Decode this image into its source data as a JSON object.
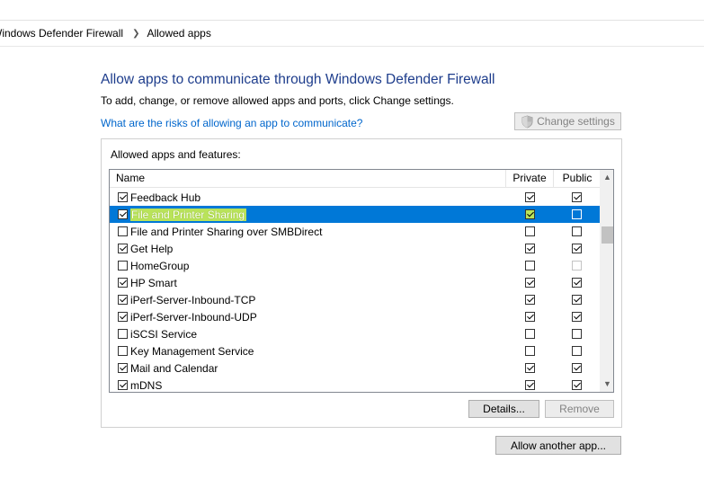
{
  "breadcrumb": {
    "items": [
      "Windows Defender Firewall",
      "Allowed apps"
    ]
  },
  "page": {
    "title": "Allow apps to communicate through Windows Defender Firewall",
    "subtitle": "To add, change, or remove allowed apps and ports, click Change settings.",
    "risk_link": "What are the risks of allowing an app to communicate?",
    "change_settings_label": "Change settings"
  },
  "group": {
    "label": "Allowed apps and features:",
    "columns": {
      "name": "Name",
      "private": "Private",
      "public": "Public"
    },
    "rows": [
      {
        "name": "Feedback Hub",
        "enabled": true,
        "private": true,
        "public": true,
        "selected": false
      },
      {
        "name": "File and Printer Sharing",
        "enabled": true,
        "private": true,
        "public": false,
        "selected": true
      },
      {
        "name": "File and Printer Sharing over SMBDirect",
        "enabled": false,
        "private": false,
        "public": false,
        "selected": false
      },
      {
        "name": "Get Help",
        "enabled": true,
        "private": true,
        "public": true,
        "selected": false
      },
      {
        "name": "HomeGroup",
        "enabled": false,
        "private": false,
        "public": false,
        "selected": false,
        "public_dim": true
      },
      {
        "name": "HP Smart",
        "enabled": true,
        "private": true,
        "public": true,
        "selected": false
      },
      {
        "name": "iPerf-Server-Inbound-TCP",
        "enabled": true,
        "private": true,
        "public": true,
        "selected": false
      },
      {
        "name": "iPerf-Server-Inbound-UDP",
        "enabled": true,
        "private": true,
        "public": true,
        "selected": false
      },
      {
        "name": "iSCSI Service",
        "enabled": false,
        "private": false,
        "public": false,
        "selected": false
      },
      {
        "name": "Key Management Service",
        "enabled": false,
        "private": false,
        "public": false,
        "selected": false
      },
      {
        "name": "Mail and Calendar",
        "enabled": true,
        "private": true,
        "public": true,
        "selected": false
      },
      {
        "name": "mDNS",
        "enabled": true,
        "private": true,
        "public": true,
        "selected": false
      }
    ],
    "details_label": "Details...",
    "remove_label": "Remove"
  },
  "allow_another_label": "Allow another app...",
  "colors": {
    "title": "#1e3d8c",
    "link": "#0066cc",
    "selection": "#0078d7",
    "highlight": "#b9e35a"
  }
}
